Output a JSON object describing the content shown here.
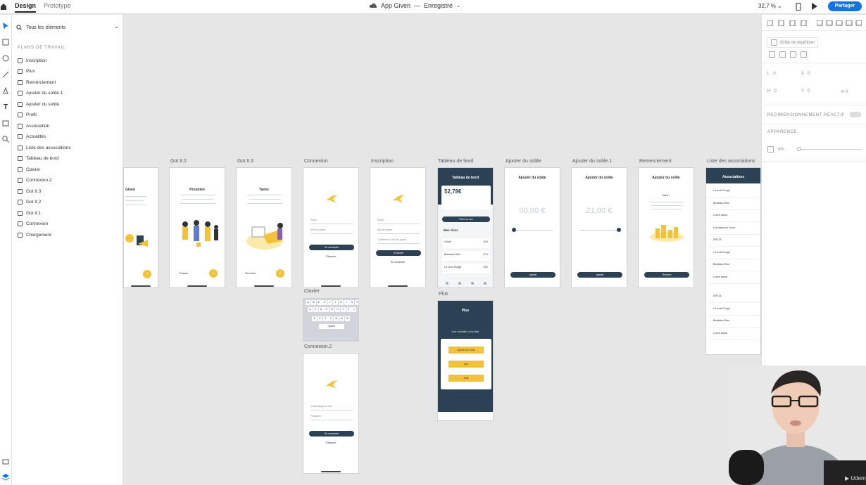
{
  "topbar": {
    "tabs": [
      "Design",
      "Prototype"
    ],
    "doc_title": "App Given",
    "doc_sep": "—",
    "doc_status": "Enregistré",
    "zoom": "32,7 %",
    "share_label": "Partager"
  },
  "layers": {
    "filter_label": "Tous les éléments",
    "section_title": "PLANS DE TRAVAIL",
    "items": [
      "Inscription",
      "Plus",
      "Remerciement",
      "Ajouter du solde 1",
      "Ajouter du solde",
      "Profil",
      "Association",
      "Actualités",
      "Liste des associations",
      "Tableau de bord",
      "Clavier",
      "Connexion.2",
      "Got It.3",
      "Got It.2",
      "Got It.1",
      "Connexion",
      "Chargement"
    ]
  },
  "props": {
    "repeat_grid": "Grille de répétition",
    "w_label": "L",
    "w_value": "0",
    "x_label": "X",
    "x_value": "0",
    "h_label": "H",
    "h_value": "0",
    "y_label": "Y",
    "y_value": "0",
    "rotation": "0",
    "responsive": "REDIMENSIONNEMENT RÉACTIF",
    "appearance": "APPARENCE",
    "opacity": "0%"
  },
  "artboards": {
    "given": {
      "title": "Given",
      "label": ""
    },
    "got2": {
      "label": "Got It.2",
      "title": "Prosdam",
      "footer": "Passer"
    },
    "got3": {
      "label": "Got It.3",
      "title": "Taxes",
      "footer": "Terminer"
    },
    "connexion": {
      "label": "Connexion",
      "field1": "Email",
      "field2": "Mot de passe",
      "button": "Se connecter",
      "link": "S'inscrire"
    },
    "inscription": {
      "label": "Inscription",
      "field1": "Email",
      "field2": "Mot de passe",
      "field3": "Confirmer le mot de passe",
      "button": "S'inscrire",
      "link": "Se connecter"
    },
    "tableau": {
      "label": "Tableau de bord",
      "title": "Tableau de bord",
      "amount": "52,78€",
      "button": "Faire un don",
      "section": "Mes dons",
      "rows": [
        {
          "name": "Ghost",
          "val": "10 €"
        },
        {
          "name": "Bordeaux Rem",
          "val": "27 €"
        },
        {
          "name": "La Croix Rouge",
          "val": "15 €"
        }
      ]
    },
    "solde": {
      "label": "Ajouter du solde",
      "title": "Ajouter du solde",
      "amount": "00,00 €",
      "button": "Ajouter"
    },
    "solde1": {
      "label": "Ajouter du solde.1",
      "title": "Ajouter du solde",
      "amount": "21,00 €",
      "button": "Ajouter"
    },
    "remerciement": {
      "label": "Remerciement",
      "title": "Ajouter du solde",
      "thanks": "Merci !",
      "button": "Terminer"
    },
    "liste": {
      "label": "Liste des associations",
      "title": "Associations",
      "items": [
        "La croix Rouge",
        "Bordeaux Rem",
        "Lorem ipsum",
        "Les restos du Cœur",
        "SPA 33",
        "La croix Rouge",
        "Bordeaux Rem",
        "Lorem ipsum",
        "SPA 33",
        "La croix Rouge",
        "Bordeaux Rem",
        "Lorem ipsum"
      ]
    },
    "clavier": {
      "label": "Clavier",
      "row1": [
        "Q",
        "W",
        "E",
        "R",
        "T",
        "Y",
        "U",
        "I",
        "O",
        "P"
      ],
      "row2": [
        "A",
        "S",
        "D",
        "F",
        "G",
        "H",
        "J",
        "K",
        "L"
      ],
      "row3": [
        "Z",
        "X",
        "C",
        "V",
        "B",
        "N",
        "M"
      ],
      "space": "space"
    },
    "connexion2": {
      "label": "Connexion.2",
      "field1": "contact@given.com",
      "field2": "Password",
      "button": "Se connecter",
      "link": "S'inscrire"
    },
    "plus": {
      "label": "Plus",
      "title": "Plus",
      "prompt": "Que souhaitez-vous faire",
      "buttons": [
        "Ajouter du solde",
        "Don",
        "Aide"
      ]
    }
  }
}
